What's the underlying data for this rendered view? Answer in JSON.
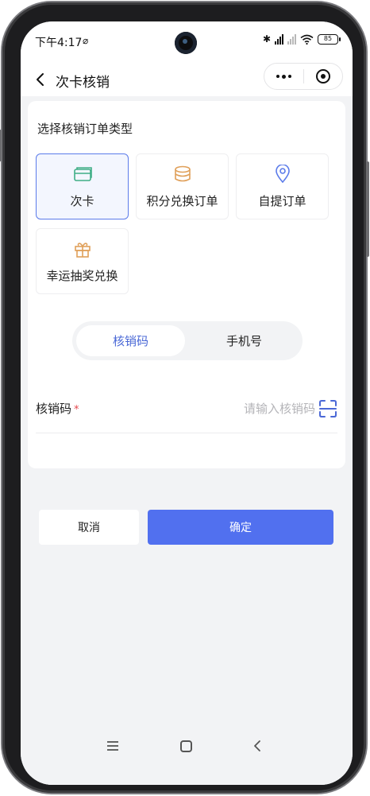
{
  "status_bar": {
    "time": "下午4:17",
    "battery": "85",
    "icons": [
      "no-disturb-icon",
      "bluetooth-icon",
      "signal-icon",
      "wifi-icon",
      "battery-icon"
    ]
  },
  "header": {
    "title": "次卡核销",
    "icons": [
      "back-icon",
      "more-icon",
      "close-miniprogram-icon"
    ]
  },
  "order_type": {
    "section_title": "选择核销订单类型",
    "options": [
      {
        "label": "次卡",
        "icon": "card-icon",
        "selected": true
      },
      {
        "label": "积分兑换订单",
        "icon": "coins-icon",
        "selected": false
      },
      {
        "label": "自提订单",
        "icon": "location-pin-icon",
        "selected": false
      },
      {
        "label": "幸运抽奖兑换",
        "icon": "gift-icon",
        "selected": false
      }
    ]
  },
  "verify_mode": {
    "options": [
      "核销码",
      "手机号"
    ],
    "active": "核销码"
  },
  "code_field": {
    "label": "核销码",
    "required_mark": "*",
    "placeholder": "请输入核销码",
    "value": ""
  },
  "actions": {
    "cancel_label": "取消",
    "confirm_label": "确定"
  },
  "colors": {
    "primary": "#5170ef",
    "active_text": "#4a68d6",
    "icon_accent": "#5b7bea",
    "icon_orange": "#e0a05a",
    "icon_green": "#3fae86",
    "page_bg": "#f2f3f5"
  }
}
